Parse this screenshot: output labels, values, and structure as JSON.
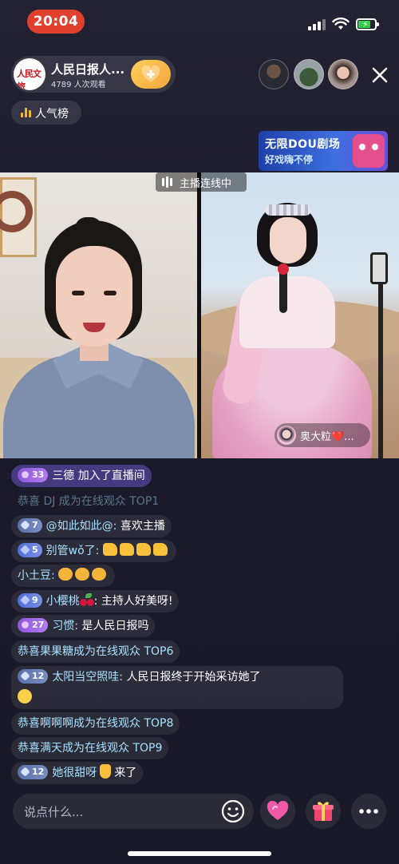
{
  "status_bar": {
    "time": "20:04"
  },
  "header": {
    "host_name": "人民日报人...",
    "host_logo_text": "人民文旅",
    "viewers_text": "4789 人次观看",
    "close_label": "✕"
  },
  "rank": {
    "label": "人气榜"
  },
  "banner": {
    "line1": "无限DOU剧场",
    "line2": "好戏嗨不停"
  },
  "video": {
    "connect_label": "主播连线中",
    "guest_name": "奥大粒❤️..."
  },
  "chat": {
    "join": {
      "level": "33",
      "name": "三德",
      "text": "加入了直播间"
    },
    "m0": {
      "text": "恭喜 DJ 成为在线观众 TOP1"
    },
    "m1": {
      "level": "7",
      "name": "@如此如此@:",
      "text": "喜欢主播"
    },
    "m2": {
      "level": "5",
      "name": "别管wǒ了:"
    },
    "m3": {
      "name": "小土豆:"
    },
    "m4": {
      "level": "9",
      "name": "小樱桃",
      "text": ": 主持人好美呀!"
    },
    "m5": {
      "level": "27",
      "name": "习惯:",
      "text": "是人民日报吗"
    },
    "m6": {
      "text": "恭喜果果糖成为在线观众 TOP6"
    },
    "m7": {
      "level": "12",
      "name": "太阳当空照哇:",
      "text": "人民日报终于开始采访她了"
    },
    "m8": {
      "text": "恭喜啊啊啊成为在线观众 TOP8"
    },
    "m9": {
      "text": "恭喜满天成为在线观众 TOP9"
    },
    "m10": {
      "level": "12",
      "name": "她很甜呀",
      "text": "来了"
    }
  },
  "bottom_bar": {
    "placeholder": "说点什么..."
  },
  "colors": {
    "accent": "#e0412f",
    "name_blue": "#a7e1ff",
    "gold": "#f4a63c"
  }
}
